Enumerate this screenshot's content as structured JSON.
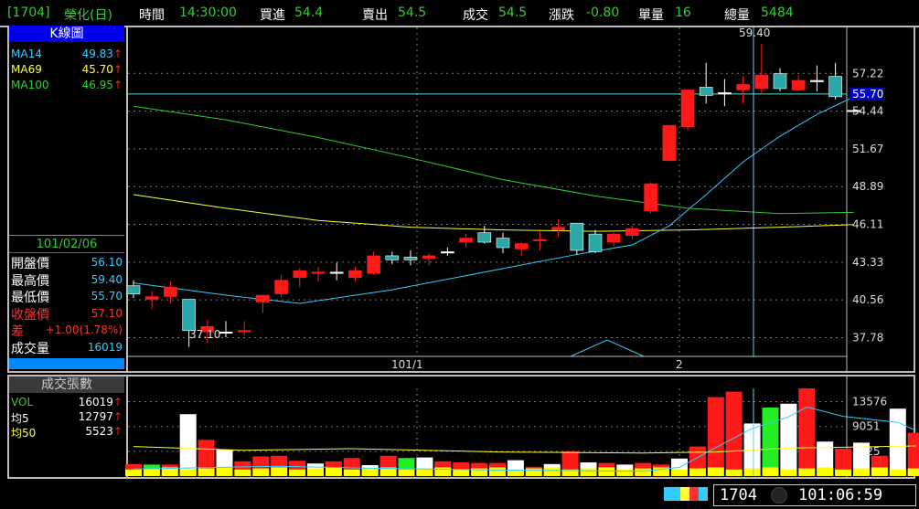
{
  "header": {
    "code": "[1704]",
    "name": "榮化(日)",
    "time_label": "時間",
    "time_value": "14:30:00",
    "bid_label": "買進",
    "bid_value": "54.4",
    "ask_label": "賣出",
    "ask_value": "54.5",
    "deal_label": "成交",
    "deal_value": "54.5",
    "change_label": "漲跌",
    "change_value": "-0.80",
    "qty_label": "單量",
    "qty_value": "16",
    "total_label": "總量",
    "total_value": "5484"
  },
  "left_panel": {
    "title": "K線圖",
    "ma": [
      {
        "label": "MA14",
        "value": "49.83",
        "arrow": "↑",
        "color": "#33ccff"
      },
      {
        "label": "MA69",
        "value": "45.70",
        "arrow": "↑",
        "color": "#ffff33"
      },
      {
        "label": "MA100",
        "value": "46.95",
        "arrow": "↑",
        "color": "#33cc33"
      }
    ],
    "date": "101/02/06",
    "quote": [
      {
        "label": "開盤價",
        "value": "56.10",
        "label_color": "#ffffff",
        "value_color": "#33ccff"
      },
      {
        "label": "最高價",
        "value": "59.40",
        "label_color": "#ffffff",
        "value_color": "#33ccff"
      },
      {
        "label": "最低價",
        "value": "55.70",
        "label_color": "#ffffff",
        "value_color": "#33ccff"
      },
      {
        "label": "收盤價",
        "value": "57.10",
        "label_color": "#ff3030",
        "value_color": "#ff3030"
      },
      {
        "label": "差",
        "value": "+1.00(1.78%)",
        "label_color": "#ff3030",
        "value_color": "#ff3030"
      },
      {
        "label": "成交量",
        "value": "16019",
        "label_color": "#ffffff",
        "value_color": "#33ccff"
      }
    ]
  },
  "volume_panel": {
    "title": "成交張數",
    "rows": [
      {
        "label": "VOL",
        "value": "16019",
        "arrow": "↑",
        "color": "#33cc33"
      },
      {
        "label": "均5",
        "value": "12797",
        "arrow": "↑",
        "color": "#ffffff"
      },
      {
        "label": "均50",
        "value": "5523",
        "arrow": "↑",
        "color": "#ffff33"
      }
    ]
  },
  "price_axis": [
    "57.22",
    "54.44",
    "51.67",
    "48.89",
    "46.11",
    "43.33",
    "40.56",
    "37.78"
  ],
  "price_marker": "55.70",
  "vol_axis": [
    "13576",
    "9051",
    "4525"
  ],
  "date_axis": [
    "101/1",
    "2"
  ],
  "annotations": {
    "high": "59.40",
    "low": "37.10"
  },
  "status_bar": {
    "code": "1704",
    "clock": "101:06:59"
  },
  "colors": {
    "up": "#ff1a1a",
    "down": "#2aa8a8",
    "flat": "#ffffff",
    "ma14": "#33ccff",
    "ma69": "#ffff33",
    "ma100": "#33cc33",
    "grid": "#777777",
    "cursor": "#66ccff"
  },
  "chart_data": [
    {
      "type": "candlestick",
      "title": "K線圖",
      "ylim": [
        36.4,
        60.6
      ],
      "candles": [
        {
          "o": 41.6,
          "h": 42.0,
          "l": 40.7,
          "c": 41.0
        },
        {
          "o": 40.6,
          "h": 41.2,
          "l": 39.9,
          "c": 40.8
        },
        {
          "o": 40.8,
          "h": 41.9,
          "l": 40.3,
          "c": 41.5
        },
        {
          "o": 40.6,
          "h": 40.6,
          "l": 37.1,
          "c": 38.3
        },
        {
          "o": 38.2,
          "h": 39.1,
          "l": 37.4,
          "c": 38.6
        },
        {
          "o": 38.2,
          "h": 39.0,
          "l": 37.8,
          "c": 38.2
        },
        {
          "o": 38.2,
          "h": 39.0,
          "l": 37.9,
          "c": 38.3
        },
        {
          "o": 40.4,
          "h": 40.9,
          "l": 39.6,
          "c": 40.9
        },
        {
          "o": 41.0,
          "h": 42.4,
          "l": 40.8,
          "c": 42.0
        },
        {
          "o": 42.2,
          "h": 42.9,
          "l": 41.5,
          "c": 42.7
        },
        {
          "o": 42.5,
          "h": 43.0,
          "l": 41.9,
          "c": 42.6
        },
        {
          "o": 42.6,
          "h": 43.3,
          "l": 42.0,
          "c": 42.6
        },
        {
          "o": 42.2,
          "h": 43.0,
          "l": 41.9,
          "c": 42.7
        },
        {
          "o": 42.5,
          "h": 44.1,
          "l": 42.4,
          "c": 43.8
        },
        {
          "o": 43.8,
          "h": 44.1,
          "l": 43.2,
          "c": 43.5
        },
        {
          "o": 43.7,
          "h": 44.2,
          "l": 43.1,
          "c": 43.5
        },
        {
          "o": 43.6,
          "h": 44.0,
          "l": 43.1,
          "c": 43.8
        },
        {
          "o": 44.1,
          "h": 44.4,
          "l": 43.8,
          "c": 44.1
        },
        {
          "o": 44.8,
          "h": 45.4,
          "l": 44.4,
          "c": 45.1
        },
        {
          "o": 45.5,
          "h": 46.0,
          "l": 44.7,
          "c": 44.8
        },
        {
          "o": 45.1,
          "h": 45.5,
          "l": 44.0,
          "c": 44.4
        },
        {
          "o": 44.3,
          "h": 44.8,
          "l": 43.8,
          "c": 44.7
        },
        {
          "o": 44.9,
          "h": 45.6,
          "l": 44.2,
          "c": 45.0
        },
        {
          "o": 45.7,
          "h": 46.5,
          "l": 45.2,
          "c": 45.9
        },
        {
          "o": 46.2,
          "h": 46.2,
          "l": 43.9,
          "c": 44.2
        },
        {
          "o": 45.4,
          "h": 45.7,
          "l": 44.0,
          "c": 44.1
        },
        {
          "o": 44.8,
          "h": 45.5,
          "l": 44.5,
          "c": 45.4
        },
        {
          "o": 45.3,
          "h": 46.0,
          "l": 45.0,
          "c": 45.8
        },
        {
          "o": 47.1,
          "h": 49.2,
          "l": 46.9,
          "c": 49.1
        },
        {
          "o": 50.8,
          "h": 53.4,
          "l": 50.8,
          "c": 53.4
        },
        {
          "o": 53.3,
          "h": 55.9,
          "l": 53.0,
          "c": 56.0
        },
        {
          "o": 56.2,
          "h": 58.0,
          "l": 55.0,
          "c": 55.6
        },
        {
          "o": 55.8,
          "h": 56.8,
          "l": 54.8,
          "c": 55.8
        },
        {
          "o": 56.0,
          "h": 57.0,
          "l": 55.0,
          "c": 56.4
        },
        {
          "o": 56.1,
          "h": 59.4,
          "l": 55.7,
          "c": 57.1
        },
        {
          "o": 57.2,
          "h": 57.6,
          "l": 55.9,
          "c": 56.1
        },
        {
          "o": 56.0,
          "h": 57.1,
          "l": 55.9,
          "c": 56.7
        },
        {
          "o": 56.7,
          "h": 57.8,
          "l": 55.9,
          "c": 56.7
        },
        {
          "o": 57.0,
          "h": 58.0,
          "l": 55.3,
          "c": 55.5
        },
        {
          "o": 54.5,
          "h": 54.5,
          "l": 54.3,
          "c": 54.5
        }
      ],
      "ma14": [
        [
          0,
          41.8
        ],
        [
          5,
          40.9
        ],
        [
          9,
          40.3
        ],
        [
          14,
          41.3
        ],
        [
          19,
          42.6
        ],
        [
          24,
          43.9
        ],
        [
          27,
          44.6
        ],
        [
          29,
          46.0
        ],
        [
          31,
          48.3
        ],
        [
          33,
          50.7
        ],
        [
          35,
          52.6
        ],
        [
          37,
          54.2
        ],
        [
          39,
          55.5
        ]
      ],
      "ma69": [
        [
          0,
          48.3
        ],
        [
          5,
          47.3
        ],
        [
          10,
          46.4
        ],
        [
          15,
          45.9
        ],
        [
          20,
          45.7
        ],
        [
          25,
          45.6
        ],
        [
          30,
          45.7
        ],
        [
          35,
          45.9
        ],
        [
          39,
          46.1
        ]
      ],
      "ma100": [
        [
          0,
          54.8
        ],
        [
          5,
          53.8
        ],
        [
          10,
          52.5
        ],
        [
          15,
          51.0
        ],
        [
          20,
          49.4
        ],
        [
          25,
          48.2
        ],
        [
          30,
          47.3
        ],
        [
          35,
          46.9
        ],
        [
          39,
          47.0
        ]
      ]
    },
    {
      "type": "bar",
      "title": "成交張數",
      "ylim": [
        0,
        16000
      ],
      "values": [
        2200,
        2100,
        2100,
        11300,
        6600,
        4800,
        2700,
        3600,
        3700,
        2800,
        2300,
        2700,
        3300,
        2000,
        3700,
        3300,
        3400,
        2700,
        2500,
        2400,
        2400,
        2900,
        1700,
        2200,
        4500,
        2500,
        2400,
        2100,
        2400,
        2100,
        3200,
        5400,
        14400,
        15400,
        9600,
        12500,
        13200,
        16000,
        6300,
        5000,
        6100,
        3700,
        12300,
        7900
      ],
      "colors": [
        "red",
        "green",
        "red",
        "white",
        "red",
        "white",
        "red",
        "red",
        "red",
        "red",
        "white",
        "red",
        "red",
        "white",
        "red",
        "green",
        "white",
        "red",
        "red",
        "red",
        "red",
        "white",
        "red",
        "white",
        "red",
        "white",
        "red",
        "white",
        "red",
        "red",
        "white",
        "red",
        "red",
        "red",
        "white",
        "green",
        "white",
        "red",
        "white",
        "red",
        "white",
        "red",
        "white",
        "red"
      ],
      "ma5": [
        [
          0,
          1300
        ],
        [
          8,
          1800
        ],
        [
          12,
          1500
        ],
        [
          20,
          1100
        ],
        [
          28,
          900
        ],
        [
          30,
          1600
        ],
        [
          32,
          5200
        ],
        [
          34,
          8700
        ],
        [
          36,
          10800
        ],
        [
          37,
          12600
        ],
        [
          39,
          10900
        ],
        [
          42,
          9800
        ],
        [
          43,
          8300
        ]
      ],
      "ma50": [
        [
          0,
          5400
        ],
        [
          6,
          4700
        ],
        [
          12,
          5000
        ],
        [
          20,
          4400
        ],
        [
          28,
          4200
        ],
        [
          32,
          4400
        ],
        [
          36,
          5100
        ],
        [
          43,
          5500
        ]
      ]
    }
  ]
}
